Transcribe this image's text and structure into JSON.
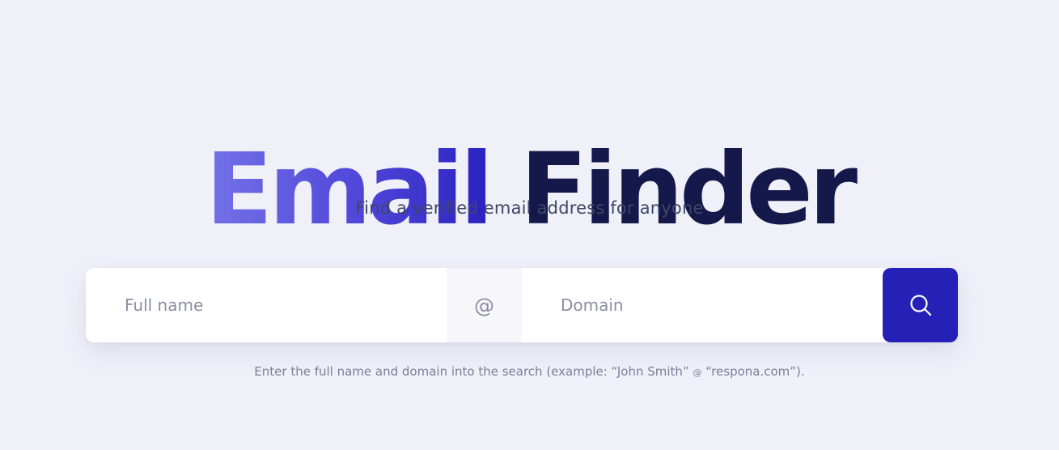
{
  "hero": {
    "title_accent": "Email",
    "title_main": "Finder",
    "subtitle": "Find a verified email address for anyone"
  },
  "search": {
    "name_placeholder": "Full name",
    "separator": "@",
    "domain_placeholder": "Domain",
    "button_icon": "search-icon"
  },
  "hint": {
    "before": "Enter the full name and domain into the search (example: “John Smith” ",
    "at": "@",
    "after": " “respona.com”)."
  },
  "colors": {
    "background": "#eff0f8",
    "title_dark": "#14184a",
    "accent_gradient_start": "#7472e8",
    "accent_gradient_end": "#2a22c0",
    "button": "#2521b7"
  }
}
